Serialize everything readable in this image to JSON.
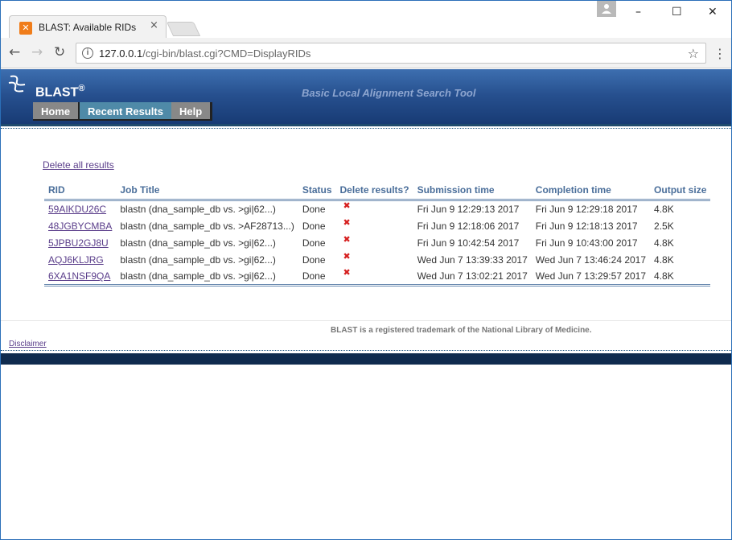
{
  "browser": {
    "tab_title": "BLAST: Available RIDs",
    "tab_favicon": "🐵",
    "tab_close": "×",
    "url_host": "127.0.0.1",
    "url_path": "/cgi-bin/blast.cgi?CMD=DisplayRIDs",
    "icons": [
      "back-icon",
      "forward-icon",
      "reload-icon",
      "info-icon",
      "star-icon",
      "menu-icon"
    ]
  },
  "header": {
    "logo": "BLAST",
    "logo_reg": "®",
    "tagline": "Basic Local Alignment Search Tool",
    "nav": {
      "home": "Home",
      "recent": "Recent Results",
      "help": "Help"
    },
    "colors": {
      "active_tab": "#4f8aa8",
      "inactive_tab": "#888888",
      "header_top": "#3d6fb0",
      "header_bottom": "#173a73"
    }
  },
  "main": {
    "delete_all": "Delete all results",
    "columns": [
      "RID",
      "Job Title",
      "Status",
      "Delete results?",
      "Submission time",
      "Completion time",
      "Output size"
    ],
    "rows": [
      {
        "rid": "59AIKDU26C",
        "title": "blastn (dna_sample_db vs. >gi|62...)",
        "status": "Done",
        "delete": "✖",
        "submitted": "Fri Jun 9 12:29:13 2017",
        "completed": "Fri Jun 9 12:29:18 2017",
        "size": "4.8K"
      },
      {
        "rid": "48JGBYCMBA",
        "title": "blastn (dna_sample_db vs. >AF28713...)",
        "status": "Done",
        "delete": "✖",
        "submitted": "Fri Jun 9 12:18:06 2017",
        "completed": "Fri Jun 9 12:18:13 2017",
        "size": "2.5K"
      },
      {
        "rid": "5JPBU2GJ8U",
        "title": "blastn (dna_sample_db vs. >gi|62...)",
        "status": "Done",
        "delete": "✖",
        "submitted": "Fri Jun 9 10:42:54 2017",
        "completed": "Fri Jun 9 10:43:00 2017",
        "size": "4.8K"
      },
      {
        "rid": "AQJ6KLJRG",
        "title": "blastn (dna_sample_db vs. >gi|62...)",
        "status": "Done",
        "delete": "✖",
        "submitted": "Wed Jun 7 13:39:33 2017",
        "completed": "Wed Jun 7 13:46:24 2017",
        "size": "4.8K"
      },
      {
        "rid": "6XA1NSF9QA",
        "title": "blastn (dna_sample_db vs. >gi|62...)",
        "status": "Done",
        "delete": "✖",
        "submitted": "Wed Jun 7 13:02:21 2017",
        "completed": "Wed Jun 7 13:29:57 2017",
        "size": "4.8K"
      }
    ]
  },
  "footer": {
    "note": "BLAST is a registered trademark of the National Library of Medicine.",
    "disclaimer": "Disclaimer"
  }
}
